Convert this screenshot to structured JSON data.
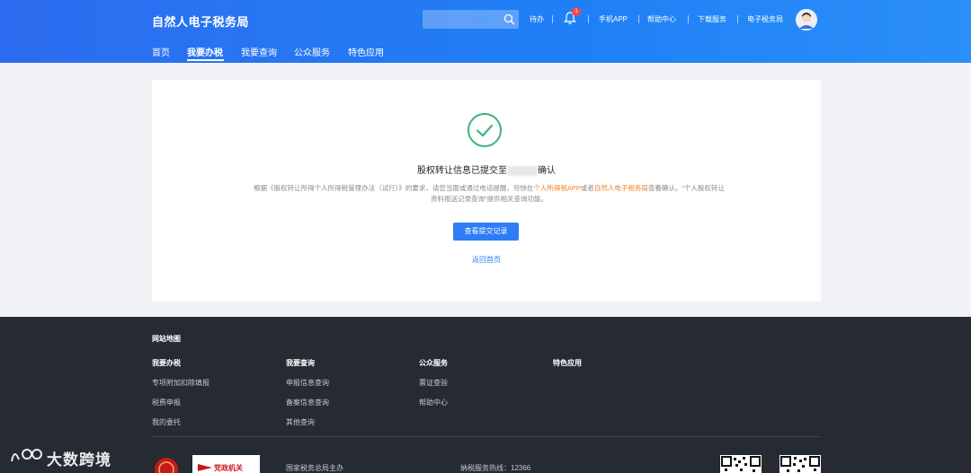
{
  "header": {
    "site_title": "自然人电子税务局",
    "search": {
      "placeholder": ""
    },
    "top_links": {
      "todo": "待办",
      "notification_count": "1",
      "mobile_app": "手机APP",
      "help_center": "帮助中心",
      "download": "下载服务",
      "e_tax_bureau": "电子税务局"
    },
    "nav": [
      {
        "label": "首页"
      },
      {
        "label": "我要办税"
      },
      {
        "label": "我要查询"
      },
      {
        "label": "公众服务"
      },
      {
        "label": "特色应用"
      }
    ],
    "active_nav": "我要办税"
  },
  "result": {
    "title_prefix": "股权转让信息已提交至",
    "title_suffix": "确认",
    "desc_1": "根据《股权转让所得个人所得税管理办法（试行）》的要求，请您当面或通过电话提醒",
    "desc_2": "，尽快在",
    "desc_hl_1": "个人所得税APP",
    "desc_3": "或者",
    "desc_hl_2": "自然人电子税务局",
    "desc_4": "查看确认。“个人股权转让资料报送记录查询”提供相关查询功能。",
    "view_records_button": "查看提交记录",
    "back_home_link": "返回首页",
    "colors": {
      "success": "#3db37a",
      "primary": "#2e7cf6",
      "highlight": "#f0802a"
    }
  },
  "footer": {
    "sitemap_title": "网站地图",
    "columns": [
      {
        "head": "我要办税",
        "links": [
          "专项附加扣除填报",
          "税费申报",
          "我的委托"
        ]
      },
      {
        "head": "我要查询",
        "links": [
          "申报信息查询",
          "备案信息查询",
          "其他查询"
        ]
      },
      {
        "head": "公众服务",
        "links": [
          "票证查验",
          "帮助中心"
        ]
      },
      {
        "head": "特色应用",
        "links": []
      }
    ],
    "host": "国家税务总局主办",
    "hotline": "纳税服务热线：12366",
    "gov_logo_text": "党政机关"
  },
  "watermark": {
    "text": "大数跨境"
  }
}
